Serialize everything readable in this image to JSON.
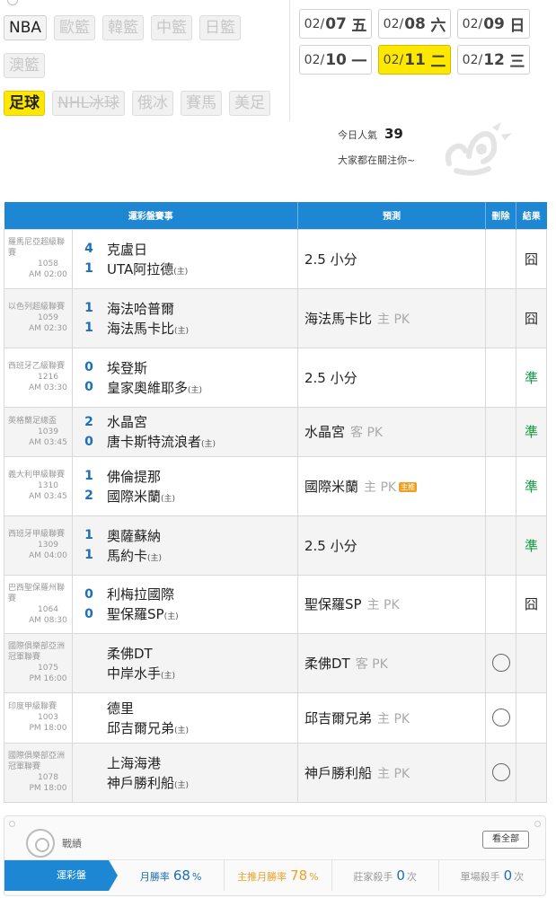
{
  "sports": {
    "row1": [
      {
        "label": "NBA",
        "state": "active"
      },
      {
        "label": "歐籃",
        "state": "disabled"
      },
      {
        "label": "韓籃",
        "state": "disabled"
      },
      {
        "label": "中籃",
        "state": "disabled"
      },
      {
        "label": "日籃",
        "state": "disabled"
      }
    ],
    "row2": [
      {
        "label": "澳籃",
        "state": "disabled"
      }
    ],
    "row3": [
      {
        "label": "足球",
        "state": "selected"
      },
      {
        "label": "NHL冰球",
        "state": "strike"
      },
      {
        "label": "俄冰",
        "state": "disabled"
      },
      {
        "label": "賽馬",
        "state": "disabled"
      },
      {
        "label": "美足",
        "state": "disabled"
      }
    ]
  },
  "dates": [
    {
      "prefix": "02/",
      "day": "07",
      "weekday": "五",
      "selected": false
    },
    {
      "prefix": "02/",
      "day": "08",
      "weekday": "六",
      "selected": false
    },
    {
      "prefix": "02/",
      "day": "09",
      "weekday": "日",
      "selected": false
    },
    {
      "prefix": "02/",
      "day": "10",
      "weekday": "一",
      "selected": false
    },
    {
      "prefix": "02/",
      "day": "11",
      "weekday": "二",
      "selected": true
    },
    {
      "prefix": "02/",
      "day": "12",
      "weekday": "三",
      "selected": false
    }
  ],
  "popularity": {
    "label": "今日人氣",
    "value": "39",
    "subtext": "大家都在關注你~"
  },
  "table": {
    "headers": {
      "event": "運彩盤賽事",
      "prediction": "預測",
      "delete": "刪除",
      "result": "結果"
    },
    "rows": [
      {
        "league": "羅馬尼亞超級聯賽",
        "code": "1058",
        "time": "AM 02:00",
        "s1": "4",
        "t1": "克盧日",
        "s2": "1",
        "t2": "UTA阿拉德",
        "home_mark": "(主)",
        "pred": "2.5 小分",
        "tag": "",
        "main_tag": "",
        "del": false,
        "result": "囧",
        "win": false
      },
      {
        "league": "以色列超級聯賽",
        "code": "1059",
        "time": "AM 02:30",
        "s1": "1",
        "t1": "海法哈普爾",
        "s2": "1",
        "t2": "海法馬卡比",
        "home_mark": "(主)",
        "pred": "海法馬卡比",
        "tag": "主 PK",
        "main_tag": "",
        "del": false,
        "result": "囧",
        "win": false
      },
      {
        "league": "西班牙乙級聯賽",
        "code": "1216",
        "time": "AM 03:30",
        "s1": "0",
        "t1": "埃登斯",
        "s2": "0",
        "t2": "皇家奧維耶多",
        "home_mark": "(主)",
        "pred": "2.5 小分",
        "tag": "",
        "main_tag": "",
        "del": false,
        "result": "準",
        "win": true
      },
      {
        "league": "英格蘭足總盃",
        "code": "1039",
        "time": "AM 03:45",
        "s1": "2",
        "t1": "水晶宮",
        "s2": "0",
        "t2": "唐卡斯特流浪者",
        "home_mark": "(主)",
        "pred": "水晶宮",
        "tag": "客 PK",
        "main_tag": "",
        "del": false,
        "result": "準",
        "win": true
      },
      {
        "league": "義大利甲級聯賽",
        "code": "1310",
        "time": "AM 03:45",
        "s1": "1",
        "t1": "佛倫提那",
        "s2": "2",
        "t2": "國際米蘭",
        "home_mark": "(主)",
        "pred": "國際米蘭",
        "tag": "主 PK",
        "main_tag": "主推",
        "del": false,
        "result": "準",
        "win": true
      },
      {
        "league": "西班牙甲級聯賽",
        "code": "1309",
        "time": "AM 04:00",
        "s1": "1",
        "t1": "奧薩蘇納",
        "s2": "1",
        "t2": "馬約卡",
        "home_mark": "(主)",
        "pred": "2.5 小分",
        "tag": "",
        "main_tag": "",
        "del": false,
        "result": "準",
        "win": true
      },
      {
        "league": "巴西聖保羅州聯賽",
        "code": "1064",
        "time": "AM 08:30",
        "s1": "0",
        "t1": "利梅拉國際",
        "s2": "0",
        "t2": "聖保羅SP",
        "home_mark": "(主)",
        "pred": "聖保羅SP",
        "tag": "主 PK",
        "main_tag": "",
        "del": false,
        "result": "囧",
        "win": false
      },
      {
        "league": "國際俱樂部亞洲冠軍聯賽",
        "code": "1075",
        "time": "PM 16:00",
        "s1": "",
        "t1": "柔佛DT",
        "s2": "",
        "t2": "中岸水手",
        "home_mark": "(主)",
        "pred": "柔佛DT",
        "tag": "客 PK",
        "main_tag": "",
        "del": true,
        "result": "",
        "win": false
      },
      {
        "league": "印度甲級聯賽",
        "code": "1003",
        "time": "PM 18:00",
        "s1": "",
        "t1": "德里",
        "s2": "",
        "t2": "邱吉爾兄弟",
        "home_mark": "(主)",
        "pred": "邱吉爾兄弟",
        "tag": "主 PK",
        "main_tag": "",
        "del": true,
        "result": "",
        "win": false
      },
      {
        "league": "國際俱樂部亞洲冠軍聯賽",
        "code": "1078",
        "time": "PM 18:00",
        "s1": "",
        "t1": "上海海港",
        "s2": "",
        "t2": "神戶勝利船",
        "home_mark": "(主)",
        "pred": "神戶勝利船",
        "tag": "主 PK",
        "main_tag": "",
        "del": true,
        "result": "",
        "win": false
      }
    ]
  },
  "record": {
    "title": "戰績",
    "view_all": "看全部",
    "tab": "運彩盤",
    "month_label": "月勝率",
    "month_value": "68",
    "home_label": "主推月勝率",
    "home_value": "78",
    "percent": "%",
    "banker_label": "莊家殺手",
    "banker_value": "0",
    "single_label": "單場殺手",
    "single_value": "0",
    "count_unit": "次"
  },
  "colors": {
    "header_blue": "#1d87d3",
    "highlight_yellow": "#ffe800",
    "win_green": "#0a9a3a",
    "score_blue": "#1c6fb8",
    "main_tag_orange": "#f0a020"
  }
}
